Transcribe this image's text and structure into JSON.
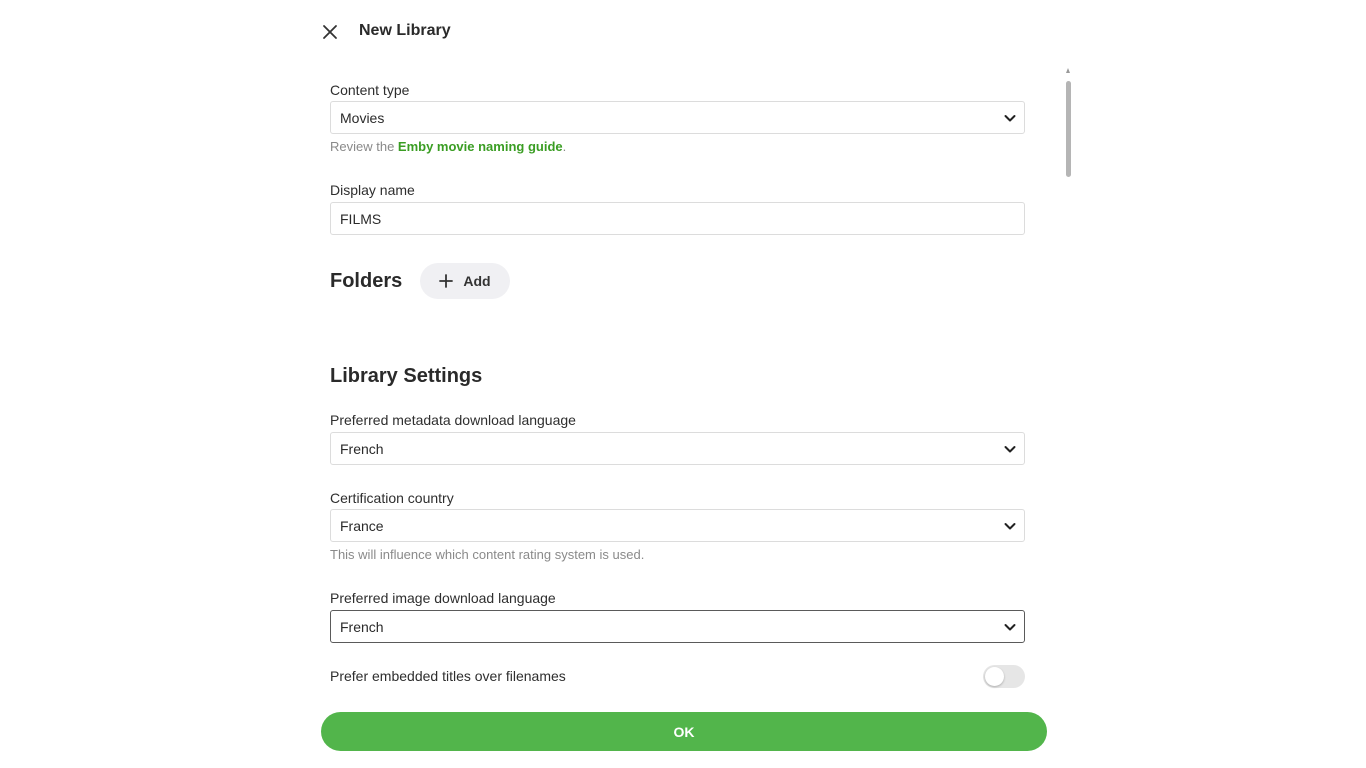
{
  "dialog": {
    "title": "New Library",
    "close_icon": "close-icon"
  },
  "content_type": {
    "label": "Content type",
    "value": "Movies",
    "hint_prefix": "Review the ",
    "hint_link": "Emby movie naming guide",
    "hint_suffix": "."
  },
  "display_name": {
    "label": "Display name",
    "value": "FILMS"
  },
  "folders": {
    "title": "Folders",
    "add_label": "Add",
    "add_icon": "plus-icon"
  },
  "library_settings": {
    "title": "Library Settings",
    "metadata_language": {
      "label": "Preferred metadata download language",
      "value": "French"
    },
    "certification_country": {
      "label": "Certification country",
      "value": "France",
      "hint": "This will influence which content rating system is used."
    },
    "image_language": {
      "label": "Preferred image download language",
      "value": "French"
    },
    "embedded_titles": {
      "label": "Prefer embedded titles over filenames",
      "enabled": false
    }
  },
  "footer": {
    "ok_label": "OK"
  },
  "colors": {
    "accent": "#52b54b",
    "link": "#3a9d23"
  }
}
